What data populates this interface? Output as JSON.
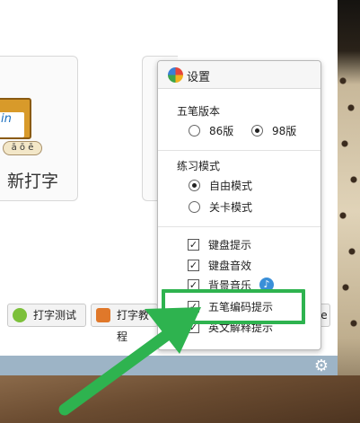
{
  "window": {
    "card_typing_label": "新打字",
    "card_icon_page_text": "in",
    "card_icon_letters": "ā ō ē"
  },
  "toolbar": {
    "test_label": "打字测试",
    "tutorial_label": "打字教程",
    "cut_label": "e"
  },
  "settings": {
    "title": "设置",
    "version_section": "五笔版本",
    "version_options": [
      {
        "label": "86版",
        "selected": false
      },
      {
        "label": "98版",
        "selected": true
      }
    ],
    "mode_section": "练习模式",
    "mode_options": [
      {
        "label": "自由模式",
        "selected": true
      },
      {
        "label": "关卡模式",
        "selected": false
      }
    ],
    "checkboxes": [
      {
        "label": "键盘提示",
        "checked": true
      },
      {
        "label": "键盘音效",
        "checked": true
      },
      {
        "label": "背景音乐",
        "checked": true
      },
      {
        "label": "五笔编码提示",
        "checked": true
      },
      {
        "label": "英文解释提示",
        "checked": true
      }
    ],
    "music_icon_glyph": "♪"
  },
  "colors": {
    "highlight": "#2eb34f",
    "statusbar": "#9db4c6"
  }
}
